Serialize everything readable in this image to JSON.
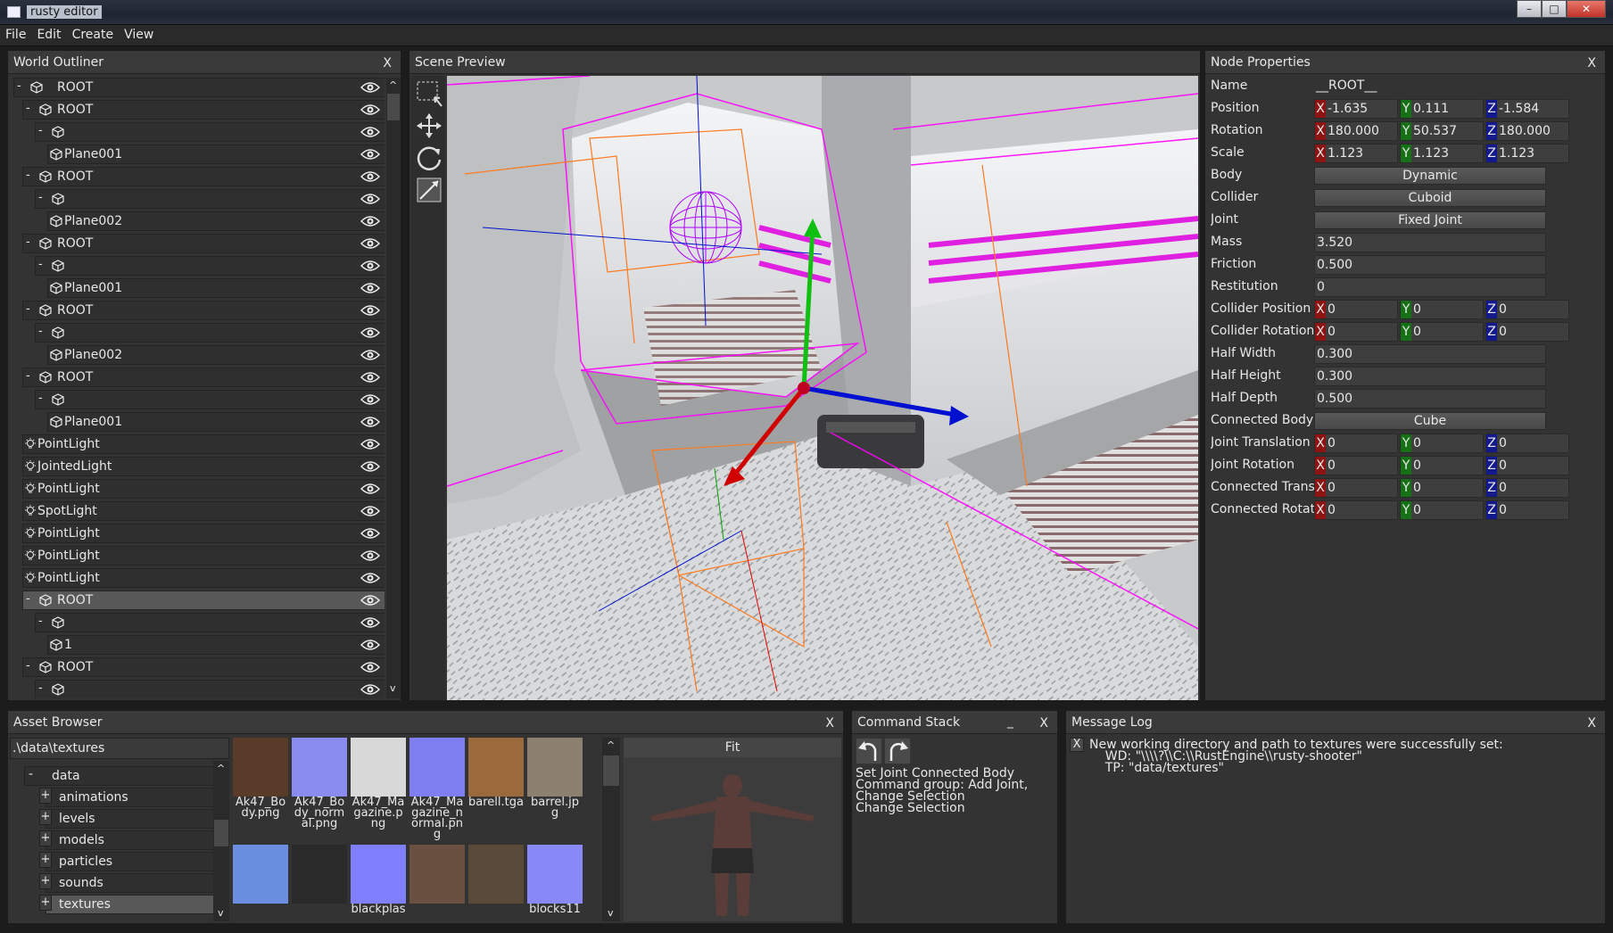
{
  "window": {
    "title": "rusty editor",
    "minimize": "–",
    "maximize": "□",
    "close": "✕"
  },
  "menu": [
    "File",
    "Edit",
    "Create",
    "View"
  ],
  "outliner": {
    "title": "World Outliner",
    "close": "X",
    "scroll_up": "^",
    "scroll_down": "v",
    "rows": [
      {
        "toggle": "-",
        "icon": "cube-icon",
        "label": "ROOT",
        "depth": 0,
        "selected": false
      },
      {
        "toggle": "-",
        "icon": "cube-icon",
        "label": "ROOT",
        "depth": 1,
        "selected": false
      },
      {
        "toggle": "-",
        "icon": "cube-icon",
        "label": "",
        "depth": 2,
        "selected": false
      },
      {
        "toggle": "",
        "icon": "cube-icon",
        "label": "Plane001",
        "depth": 3,
        "selected": false
      },
      {
        "toggle": "-",
        "icon": "cube-icon",
        "label": "ROOT",
        "depth": 1,
        "selected": false
      },
      {
        "toggle": "-",
        "icon": "cube-icon",
        "label": "",
        "depth": 2,
        "selected": false
      },
      {
        "toggle": "",
        "icon": "cube-icon",
        "label": "Plane002",
        "depth": 3,
        "selected": false
      },
      {
        "toggle": "-",
        "icon": "cube-icon",
        "label": "ROOT",
        "depth": 1,
        "selected": false
      },
      {
        "toggle": "-",
        "icon": "cube-icon",
        "label": "",
        "depth": 2,
        "selected": false
      },
      {
        "toggle": "",
        "icon": "cube-icon",
        "label": "Plane001",
        "depth": 3,
        "selected": false
      },
      {
        "toggle": "-",
        "icon": "cube-icon",
        "label": "ROOT",
        "depth": 1,
        "selected": false
      },
      {
        "toggle": "-",
        "icon": "cube-icon",
        "label": "",
        "depth": 2,
        "selected": false
      },
      {
        "toggle": "",
        "icon": "cube-icon",
        "label": "Plane002",
        "depth": 3,
        "selected": false
      },
      {
        "toggle": "-",
        "icon": "cube-icon",
        "label": "ROOT",
        "depth": 1,
        "selected": false
      },
      {
        "toggle": "-",
        "icon": "cube-icon",
        "label": "",
        "depth": 2,
        "selected": false
      },
      {
        "toggle": "",
        "icon": "cube-icon",
        "label": "Plane001",
        "depth": 3,
        "selected": false
      },
      {
        "toggle": "",
        "icon": "light-icon",
        "label": "PointLight",
        "depth": 1,
        "selected": false
      },
      {
        "toggle": "",
        "icon": "light-icon",
        "label": "JointedLight",
        "depth": 1,
        "selected": false
      },
      {
        "toggle": "",
        "icon": "light-icon",
        "label": "PointLight",
        "depth": 1,
        "selected": false
      },
      {
        "toggle": "",
        "icon": "light-icon",
        "label": "SpotLight",
        "depth": 1,
        "selected": false
      },
      {
        "toggle": "",
        "icon": "light-icon",
        "label": "PointLight",
        "depth": 1,
        "selected": false
      },
      {
        "toggle": "",
        "icon": "light-icon",
        "label": "PointLight",
        "depth": 1,
        "selected": false
      },
      {
        "toggle": "",
        "icon": "light-icon",
        "label": "PointLight",
        "depth": 1,
        "selected": false
      },
      {
        "toggle": "-",
        "icon": "cube-icon",
        "label": "ROOT",
        "depth": 1,
        "selected": true
      },
      {
        "toggle": "-",
        "icon": "cube-icon",
        "label": "",
        "depth": 2,
        "selected": false
      },
      {
        "toggle": "",
        "icon": "cube-icon",
        "label": "1",
        "depth": 3,
        "selected": false
      },
      {
        "toggle": "-",
        "icon": "cube-icon",
        "label": "ROOT",
        "depth": 1,
        "selected": false
      },
      {
        "toggle": "-",
        "icon": "cube-icon",
        "label": "",
        "depth": 2,
        "selected": false
      }
    ]
  },
  "scene": {
    "title": "Scene Preview",
    "tools": [
      "select-tool-icon",
      "move-tool-icon",
      "rotate-tool-icon",
      "scale-tool-icon"
    ]
  },
  "properties": {
    "title": "Node Properties",
    "close": "X",
    "name_label": "Name",
    "name_value": "__ROOT__",
    "position": {
      "label": "Position",
      "x": "-1.635",
      "y": "0.111",
      "z": "-1.584"
    },
    "rotation": {
      "label": "Rotation",
      "x": "180.000",
      "y": "50.537",
      "z": "180.000"
    },
    "scale": {
      "label": "Scale",
      "x": "1.123",
      "y": "1.123",
      "z": "1.123"
    },
    "body": {
      "label": "Body",
      "value": "Dynamic"
    },
    "collider": {
      "label": "Collider",
      "value": "Cuboid"
    },
    "joint": {
      "label": "Joint",
      "value": "Fixed Joint"
    },
    "mass": {
      "label": "Mass",
      "value": "3.520"
    },
    "friction": {
      "label": "Friction",
      "value": "0.500"
    },
    "restitution": {
      "label": "Restitution",
      "value": "0"
    },
    "collider_position": {
      "label": "Collider Position",
      "x": "0",
      "y": "0",
      "z": "0"
    },
    "collider_rotation": {
      "label": "Collider Rotation",
      "x": "0",
      "y": "0",
      "z": "0"
    },
    "half_width": {
      "label": "Half Width",
      "value": "0.300"
    },
    "half_height": {
      "label": "Half Height",
      "value": "0.300"
    },
    "half_depth": {
      "label": "Half Depth",
      "value": "0.500"
    },
    "connected_body": {
      "label": "Connected Body",
      "value": "Cube"
    },
    "joint_translation": {
      "label": "Joint Translation",
      "x": "0",
      "y": "0",
      "z": "0"
    },
    "joint_rotation": {
      "label": "Joint Rotation",
      "x": "0",
      "y": "0",
      "z": "0"
    },
    "connected_translation": {
      "label": "Connected Transla",
      "x": "0",
      "y": "0",
      "z": "0"
    },
    "connected_rotation": {
      "label": "Connected Rotatio",
      "x": "0",
      "y": "0",
      "z": "0"
    },
    "axis_x": "X",
    "axis_y": "Y",
    "axis_z": "Z"
  },
  "assets": {
    "title": "Asset Browser",
    "close": "X",
    "path": ".\\data\\textures",
    "root": {
      "toggle": "-",
      "label": "data"
    },
    "folders": [
      {
        "label": "animations",
        "toggle": "+",
        "selected": false
      },
      {
        "label": "levels",
        "toggle": "+",
        "selected": false
      },
      {
        "label": "models",
        "toggle": "+",
        "selected": false
      },
      {
        "label": "particles",
        "toggle": "+",
        "selected": false
      },
      {
        "label": "sounds",
        "toggle": "+",
        "selected": false
      },
      {
        "label": "textures",
        "toggle": "+",
        "selected": true
      }
    ],
    "items": [
      {
        "name": "Ak47_Body.png",
        "color": "#5a3a28"
      },
      {
        "name": "Ak47_Body_normal.png",
        "color": "#8a8cf0"
      },
      {
        "name": "Ak47_Magazine.png",
        "color": "#d8d8d8"
      },
      {
        "name": "Ak47_Magazine_normal.png",
        "color": "#7f7ff2"
      },
      {
        "name": "barell.tga",
        "color": "#9a6a3a"
      },
      {
        "name": "barrel.jpg",
        "color": "#8c8070"
      },
      {
        "name": "",
        "color": "#6a8ee0"
      },
      {
        "name": "",
        "color": "#2a2a2a"
      },
      {
        "name": "blackplas",
        "color": "#8080ff"
      },
      {
        "name": "",
        "color": "#6a5040"
      },
      {
        "name": "",
        "color": "#5a4a3a"
      },
      {
        "name": "blocks11",
        "color": "#8888f8"
      }
    ],
    "preview_fit": "Fit",
    "scroll_up": "^",
    "scroll_down": "v"
  },
  "commands": {
    "title": "Command Stack",
    "minimize": "_",
    "close": "X",
    "entries": [
      "Set Joint Connected Body",
      "Command group: Add Joint,",
      "Change Selection",
      "Change Selection"
    ]
  },
  "log": {
    "title": "Message Log",
    "close": "X",
    "clear": "X",
    "lines": [
      "New working directory and path to textures were successfully set:",
      "    WD: \"\\\\\\\\?\\\\C:\\\\RustEngine\\\\rusty-shooter\"",
      "    TP: \"data/textures\""
    ]
  }
}
